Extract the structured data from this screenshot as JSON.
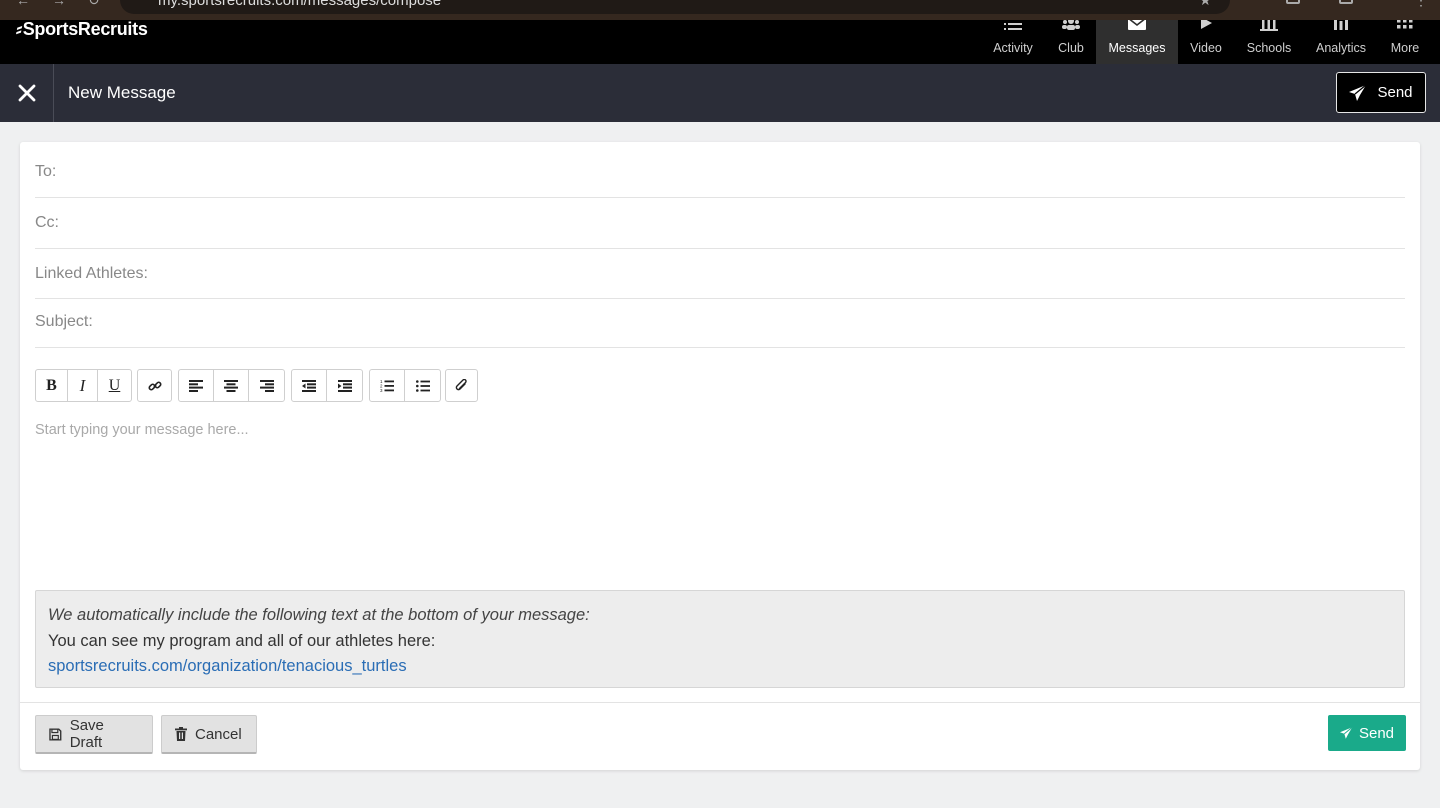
{
  "browser": {
    "url": "my.sportsrecruits.com/messages/compose"
  },
  "brand": {
    "name": "SportsRecruits",
    "mark": "⸗"
  },
  "nav": {
    "items": [
      {
        "label": "Activity",
        "icon": "list-icon"
      },
      {
        "label": "Club",
        "icon": "group-icon"
      },
      {
        "label": "Messages",
        "icon": "envelope-icon",
        "active": true
      },
      {
        "label": "Video",
        "icon": "play-icon"
      },
      {
        "label": "Schools",
        "icon": "building-icon"
      },
      {
        "label": "Analytics",
        "icon": "bar-chart-icon"
      },
      {
        "label": "More",
        "icon": "grid-icon"
      }
    ]
  },
  "header": {
    "title": "New Message",
    "send_label": "Send"
  },
  "form": {
    "to_label": "To:",
    "cc_label": "Cc:",
    "linked_label": "Linked Athletes:",
    "subject_label": "Subject:",
    "to_value": "",
    "cc_value": "",
    "linked_value": "",
    "subject_value": ""
  },
  "editor": {
    "placeholder": "Start typing your message here..."
  },
  "footer_note": {
    "intro": "We automatically include the following text at the bottom of your message:",
    "line": "You can see my program and all of our athletes here:",
    "link": "sportsrecruits.com/organization/tenacious_turtles"
  },
  "actions": {
    "save_draft": "Save Draft",
    "cancel": "Cancel",
    "send": "Send"
  },
  "colors": {
    "nav_bg": "#000000",
    "header_bg": "#2b2d38",
    "send_green": "#1aaa8a",
    "link_blue": "#2a6db5",
    "page_bg": "#eff0f1"
  }
}
